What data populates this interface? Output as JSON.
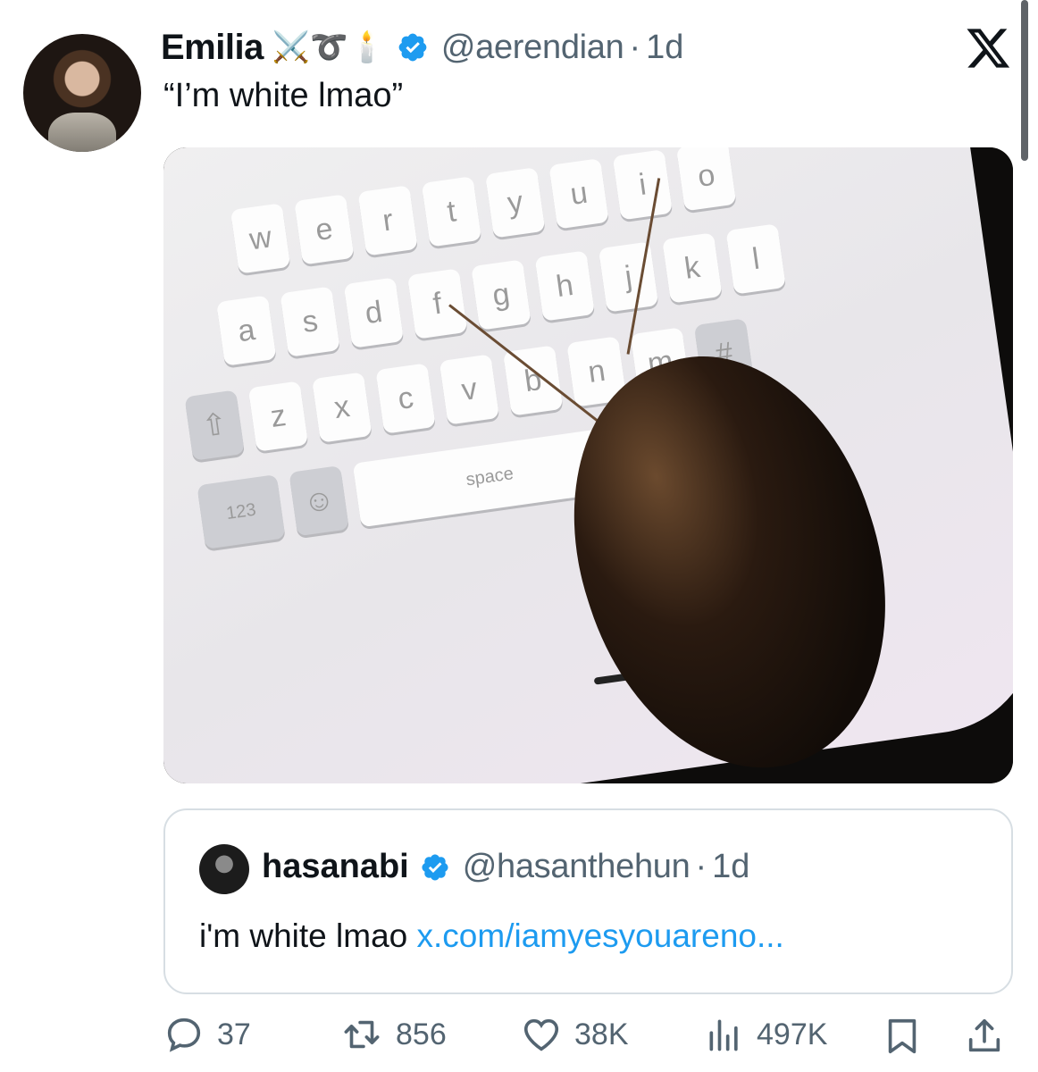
{
  "tweet": {
    "author_name": "Emilia",
    "author_emojis": "⚔️➰🕯️",
    "author_handle": "@aerendian",
    "separator": "·",
    "time": "1d",
    "text": "“I’m white lmao”",
    "verified_color": "#1d9bf0"
  },
  "media": {
    "keyboard_rows": [
      [
        "w",
        "e",
        "r",
        "t",
        "y",
        "u",
        "i",
        "o"
      ],
      [
        "a",
        "s",
        "d",
        "f",
        "g",
        "h",
        "j",
        "k",
        "l"
      ],
      [
        "z",
        "x",
        "c",
        "v",
        "b",
        "n",
        "m"
      ]
    ],
    "space_label": "space",
    "num_label": "123",
    "hash_label": "#"
  },
  "quoted_tweet": {
    "author_name": "hasanabi",
    "author_handle": "@hasanthehun",
    "separator": "·",
    "time": "1d",
    "text": "i'm white lmao",
    "link_text": "x.com/iamyesyouareno..."
  },
  "actions": {
    "replies": "37",
    "retweets": "856",
    "likes": "38K",
    "views": "497K"
  },
  "colors": {
    "text": "#0f1419",
    "secondary": "#536471",
    "link": "#1d9bf0",
    "border": "#d7dee3"
  }
}
